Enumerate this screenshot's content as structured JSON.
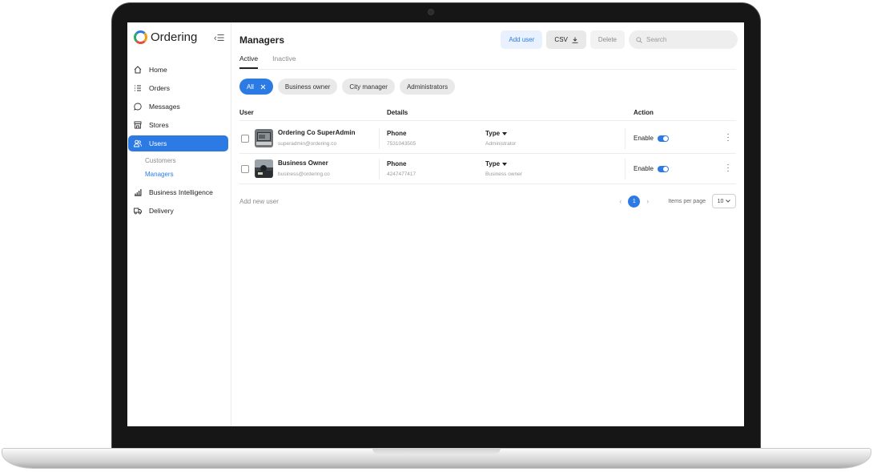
{
  "app": {
    "logo_text": "Ordering",
    "collapse_icon": "collapse-sidebar-icon"
  },
  "sidebar": {
    "items": [
      {
        "label": "Home",
        "icon": "home-icon"
      },
      {
        "label": "Orders",
        "icon": "list-icon"
      },
      {
        "label": "Messages",
        "icon": "chat-icon"
      },
      {
        "label": "Stores",
        "icon": "store-icon"
      },
      {
        "label": "Users",
        "icon": "users-icon",
        "active": true
      },
      {
        "label": "Business Intelligence",
        "icon": "bar-chart-icon"
      },
      {
        "label": "Delivery",
        "icon": "truck-icon"
      }
    ],
    "sub_items": [
      {
        "label": "Customers"
      },
      {
        "label": "Managers",
        "active": true
      }
    ]
  },
  "header": {
    "title": "Managers",
    "add_user": "Add user",
    "csv": "CSV",
    "delete": "Delete",
    "search_placeholder": "Search"
  },
  "tabs": [
    "Active",
    "Inactive"
  ],
  "filters": [
    "All",
    "Business owner",
    "City manager",
    "Administrators"
  ],
  "table": {
    "headers": {
      "user": "User",
      "details": "Details",
      "action": "Action"
    },
    "rows": [
      {
        "name": "Ordering Co SuperAdmin",
        "email": "superadmin@ordering.co",
        "phone_label": "Phone",
        "phone": "7531043505",
        "type_label": "Type",
        "type": "Administrator",
        "status": "Enable",
        "enabled": true
      },
      {
        "name": "Business Owner",
        "email": "business@ordering.co",
        "phone_label": "Phone",
        "phone": "4247477417",
        "type_label": "Type",
        "type": "Business owner",
        "status": "Enable",
        "enabled": true
      }
    ]
  },
  "footer": {
    "add_new": "Add new user",
    "current_page": "1",
    "items_per_page_label": "Items per page",
    "items_per_page": "10"
  },
  "colors": {
    "accent": "#2c7be5"
  }
}
